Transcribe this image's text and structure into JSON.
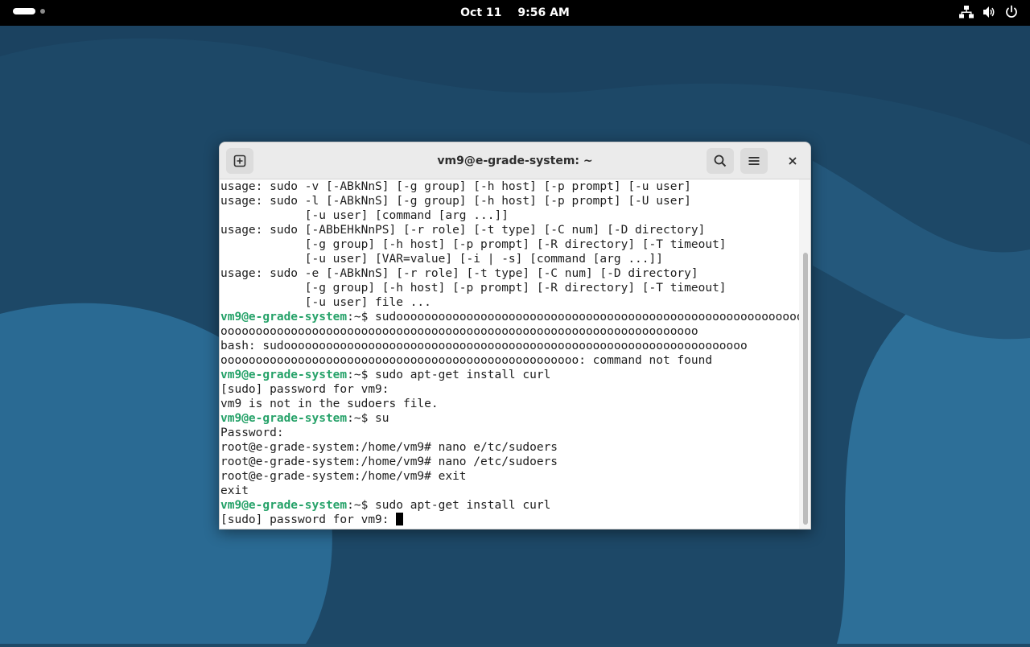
{
  "topbar": {
    "date": "Oct 11",
    "time": "9:56 AM",
    "icons": [
      "network-icon",
      "volume-icon",
      "power-icon"
    ]
  },
  "window": {
    "title": "vm9@e-grade-system: ~",
    "new_tab_icon": "new-tab-icon",
    "search_icon": "search-icon",
    "menu_icon": "hamburger-menu-icon",
    "close_icon": "close-icon"
  },
  "terminal": {
    "lines": [
      {
        "text": "usage: sudo -v [-ABkNnS] [-g group] [-h host] [-p prompt] [-u user]"
      },
      {
        "text": "usage: sudo -l [-ABkNnS] [-g group] [-h host] [-p prompt] [-U user]"
      },
      {
        "text": "            [-u user] [command [arg ...]]"
      },
      {
        "text": "usage: sudo [-ABbEHkNnPS] [-r role] [-t type] [-C num] [-D directory]"
      },
      {
        "text": "            [-g group] [-h host] [-p prompt] [-R directory] [-T timeout]"
      },
      {
        "text": "            [-u user] [VAR=value] [-i | -s] [command [arg ...]]"
      },
      {
        "text": "usage: sudo -e [-ABkNnS] [-r role] [-t type] [-C num] [-D directory]"
      },
      {
        "text": "            [-g group] [-h host] [-p prompt] [-R directory] [-T timeout]"
      },
      {
        "text": "            [-u user] file ..."
      },
      {
        "prompt": "vm9@e-grade-system",
        "text": ":~$ sudoooooooooooooooooooooooooooooooooooooooooooooooooooooooooooo"
      },
      {
        "text": "oooooooooooooooooooooooooooooooooooooooooooooooooooooooooooooooooooo"
      },
      {
        "text": "bash: sudoooooooooooooooooooooooooooooooooooooooooooooooooooooooooooooooooo"
      },
      {
        "text": "ooooooooooooooooooooooooooooooooooooooooooooooooooo: command not found"
      },
      {
        "prompt": "vm9@e-grade-system",
        "text": ":~$ sudo apt-get install curl"
      },
      {
        "text": "[sudo] password for vm9:"
      },
      {
        "text": "vm9 is not in the sudoers file."
      },
      {
        "prompt": "vm9@e-grade-system",
        "text": ":~$ su"
      },
      {
        "text": "Password:"
      },
      {
        "text": "root@e-grade-system:/home/vm9# nano e/tc/sudoers"
      },
      {
        "text": "root@e-grade-system:/home/vm9# nano /etc/sudoers"
      },
      {
        "text": "root@e-grade-system:/home/vm9# exit"
      },
      {
        "text": "exit"
      },
      {
        "prompt": "vm9@e-grade-system",
        "text": ":~$ sudo apt-get install curl"
      },
      {
        "text": "[sudo] password for vm9: ",
        "cursor": true
      }
    ]
  },
  "colors": {
    "prompt_green": "#26a269",
    "desktop_blue": "#1e4a68"
  }
}
